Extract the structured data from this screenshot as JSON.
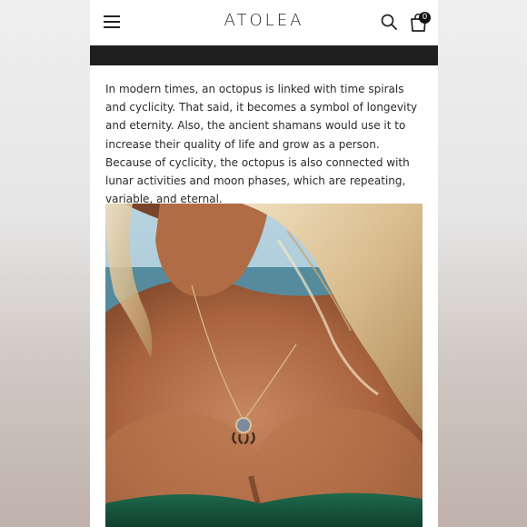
{
  "header": {
    "logo_text": "ATOLEA",
    "cart_count": "0",
    "icons": [
      "menu-icon",
      "search-icon",
      "cart-icon"
    ]
  },
  "article": {
    "paragraph": "In modern times, an octopus is linked with time spirals and cyclicity. That said, it becomes a symbol of longevity and eternity. Also, the ancient shamans would use it to increase their quality of life and grow as a person. Because of cyclicity, the octopus is also connected with lunar activities and moon phases, which are repeating, variable, and eternal."
  },
  "colors": {
    "announcement_bar": "#1f1f1f",
    "text": "#2a2a2a",
    "badge": "#111111"
  }
}
